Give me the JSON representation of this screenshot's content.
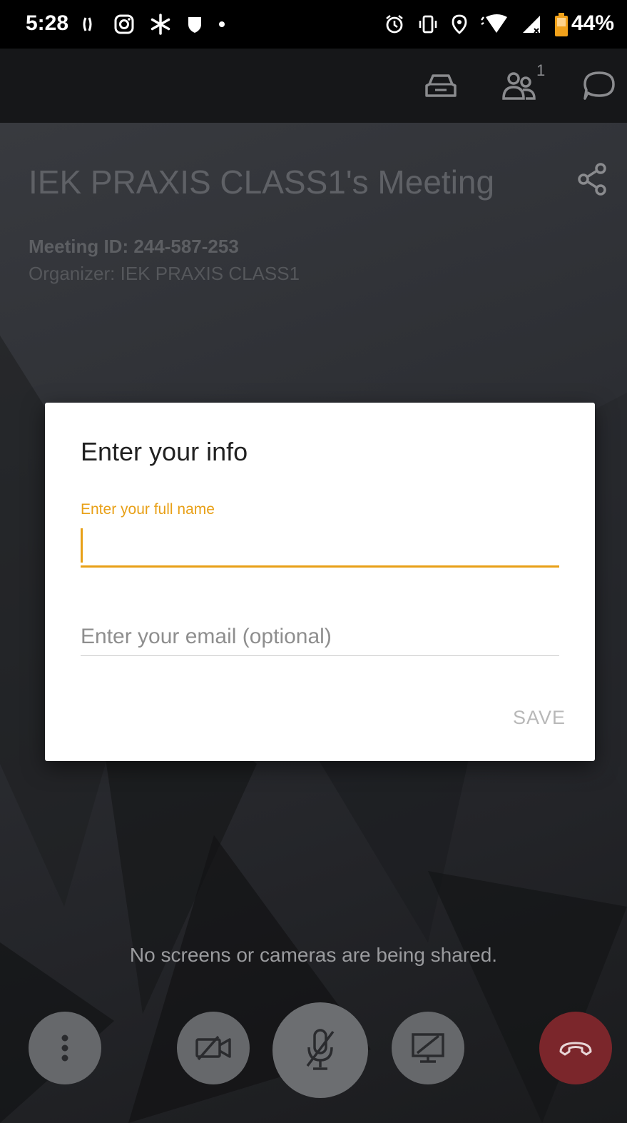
{
  "status_bar": {
    "time": "5:28",
    "battery_percent": "44%",
    "left_icons": [
      "vibrate-signal-icon",
      "instagram-icon",
      "snowflake-icon",
      "shield-icon",
      "dot-icon"
    ],
    "right_icons": [
      "alarm-icon",
      "vibrate-icon",
      "location-icon",
      "wifi-icon",
      "cell-signal-icon",
      "battery-icon"
    ]
  },
  "top_bar": {
    "icons": [
      "car-mode-icon",
      "participants-icon",
      "chat-icon"
    ],
    "participants_count": "1"
  },
  "meeting": {
    "title": "IEK PRAXIS CLASS1's Meeting",
    "meeting_id": "Meeting ID: 244-587-253",
    "organizer": "Organizer: IEK PRAXIS CLASS1",
    "share_status": "No screens or cameras are being shared."
  },
  "dialog": {
    "title": "Enter your info",
    "name_label": "Enter your full name",
    "name_value": "",
    "email_placeholder": "Enter your email (optional)",
    "email_value": "",
    "save_label": "SAVE"
  },
  "controls": [
    "more-options-icon",
    "camera-off-icon",
    "microphone-off-icon",
    "screen-share-off-icon",
    "hang-up-icon"
  ],
  "colors": {
    "accent": "#e8a017",
    "hangup": "#7b262b",
    "dialog_bg": "#ffffff",
    "topbar_bg": "#161719"
  }
}
